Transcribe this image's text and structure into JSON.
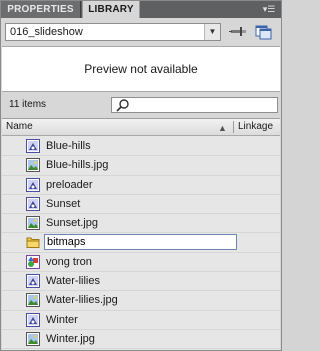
{
  "tabs": [
    {
      "label": "PROPERTIES",
      "active": false
    },
    {
      "label": "LIBRARY",
      "active": true
    }
  ],
  "menu_icon": "panel-menu-icon",
  "library": {
    "selected": "016_slideshow",
    "pin_icon": "pin-icon",
    "new_library_icon": "new-library-panel-icon"
  },
  "preview": {
    "message": "Preview not available"
  },
  "count": {
    "text": "11 items"
  },
  "search": {
    "value": "",
    "placeholder": ""
  },
  "columns": {
    "name": "Name",
    "linkage": "Linkage"
  },
  "items": [
    {
      "name": "Blue-hills",
      "type": "movieclip",
      "indent": 1
    },
    {
      "name": "Blue-hills.jpg",
      "type": "bitmap",
      "indent": 1
    },
    {
      "name": "preloader",
      "type": "movieclip",
      "indent": 1
    },
    {
      "name": "Sunset",
      "type": "movieclip",
      "indent": 1
    },
    {
      "name": "Sunset.jpg",
      "type": "bitmap",
      "indent": 1
    },
    {
      "name": "bitmaps",
      "type": "folder",
      "indent": 1,
      "editing": true
    },
    {
      "name": "vong tron",
      "type": "graphic",
      "indent": 1
    },
    {
      "name": "Water-lilies",
      "type": "movieclip",
      "indent": 1
    },
    {
      "name": "Water-lilies.jpg",
      "type": "bitmap",
      "indent": 1
    },
    {
      "name": "Winter",
      "type": "movieclip",
      "indent": 1
    },
    {
      "name": "Winter.jpg",
      "type": "bitmap",
      "indent": 1
    }
  ],
  "colors": {
    "tabbar": "#5f6061",
    "accent_edit_border": "#6d87b0"
  }
}
